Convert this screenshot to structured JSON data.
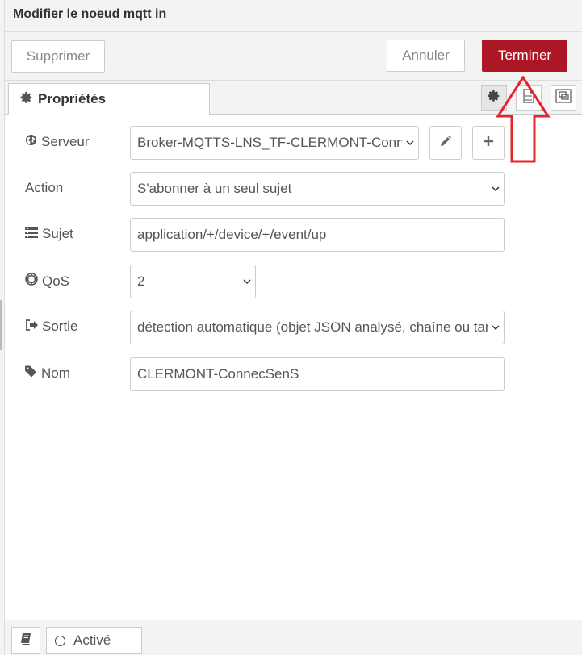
{
  "dialog": {
    "title": "Modifier le noeud mqtt in"
  },
  "toolbar": {
    "delete_label": "Supprimer",
    "cancel_label": "Annuler",
    "done_label": "Terminer",
    "done_color": "#ad1625"
  },
  "tabs": {
    "properties_label": "Propriétés",
    "icons": [
      "gear-icon",
      "description-icon",
      "appearance-icon"
    ]
  },
  "form": {
    "server": {
      "label": "Serveur",
      "value": "Broker-MQTTS-LNS_TF-CLERMONT-ConnecSenS",
      "icon": "globe-icon"
    },
    "action": {
      "label": "Action",
      "value": "S'abonner à un seul sujet"
    },
    "topic": {
      "label": "Sujet",
      "value": "application/+/device/+/event/up",
      "icon": "tasks-icon"
    },
    "qos": {
      "label": "QoS",
      "value": "2",
      "icon": "empire-icon"
    },
    "output": {
      "label": "Sortie",
      "value": "détection automatique (objet JSON analysé, chaîne ou tampon)",
      "icon": "sign-out-icon"
    },
    "name": {
      "label": "Nom",
      "value": "CLERMONT-ConnecSenS",
      "icon": "tag-icon"
    }
  },
  "footer": {
    "enabled_label": "Activé"
  },
  "annotation": {
    "arrow_color": "#e3242b"
  }
}
